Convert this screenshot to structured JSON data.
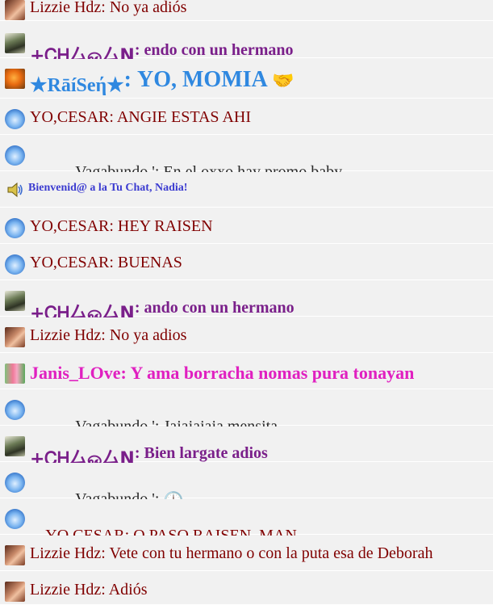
{
  "chat": {
    "messages": [
      {
        "user": "Lizzie Hdz",
        "sep": ": ",
        "text": "No ya adiós"
      },
      {
        "user": "+ᏟᎻ厶ஓ厶Ν",
        "sep": ": ",
        "text": "endo con un hermano"
      },
      {
        "user": "★RāíSeή★",
        "sep": ": ",
        "text": "YO, MOMIA",
        "emoji": "🤝"
      },
      {
        "user": "YO,CESAR",
        "sep": ": ",
        "text": "ANGIE ESTAS AHI"
      },
      {
        "user": "-      Vagabundo '",
        "sep": ": ",
        "text": "En el oxxo hay promo baby."
      },
      {
        "system": "Bienvenid@ a la Tu Chat, Nadia!"
      },
      {
        "user": "YO,CESAR",
        "sep": ": ",
        "text": "HEY RAISEN"
      },
      {
        "user": "YO,CESAR",
        "sep": ": ",
        "text": "BUENAS"
      },
      {
        "user": "+ᏟᎻ厶ஓ厶Ν",
        "sep": ": ",
        "text": "ando con un hermano"
      },
      {
        "user": "Lizzie Hdz",
        "sep": ": ",
        "text": "No ya adios"
      },
      {
        "user": "Janis_LOve",
        "sep": ": ",
        "text": "Y ama borracha nomas pura tonayan"
      },
      {
        "user": "-      Vagabundo '",
        "sep": ": ",
        "text": "Jajajajaja mensita"
      },
      {
        "user": "+ᏟᎻ厶ஓ厶Ν",
        "sep": ": ",
        "text": "Bien largate adios"
      },
      {
        "user": "-      Vagabundo '",
        "sep": ": ",
        "text": "",
        "emoji": "🕛"
      },
      {
        "user": "YO,CESAR",
        "sep": ": ",
        "text": "Q PASO RAISEN  MAN"
      },
      {
        "user": "Lizzie Hdz",
        "sep": ": ",
        "text": "Vete con tu hermano o con la puta esa de Deborah"
      },
      {
        "user": "Lizzie Hdz",
        "sep": ": ",
        "text": "Adiós"
      }
    ]
  },
  "icons": {
    "lizzie": "profile-photo-icon",
    "chaan": "profile-photo-icon",
    "raisen": "fox-avatar-icon",
    "cesar": "swirl-avatar-icon",
    "janis": "flowers-avatar-icon",
    "system": "speaker-icon"
  },
  "colors": {
    "row_bg": "#f1f1f1",
    "lizzie": "#800000",
    "cesar": "#800000",
    "vagabundo": "#2a2a2a",
    "chaan": "#7a1f8a",
    "raisen": "#2f88e0",
    "janis": "#e020c0",
    "system": "#3b3bd0"
  }
}
